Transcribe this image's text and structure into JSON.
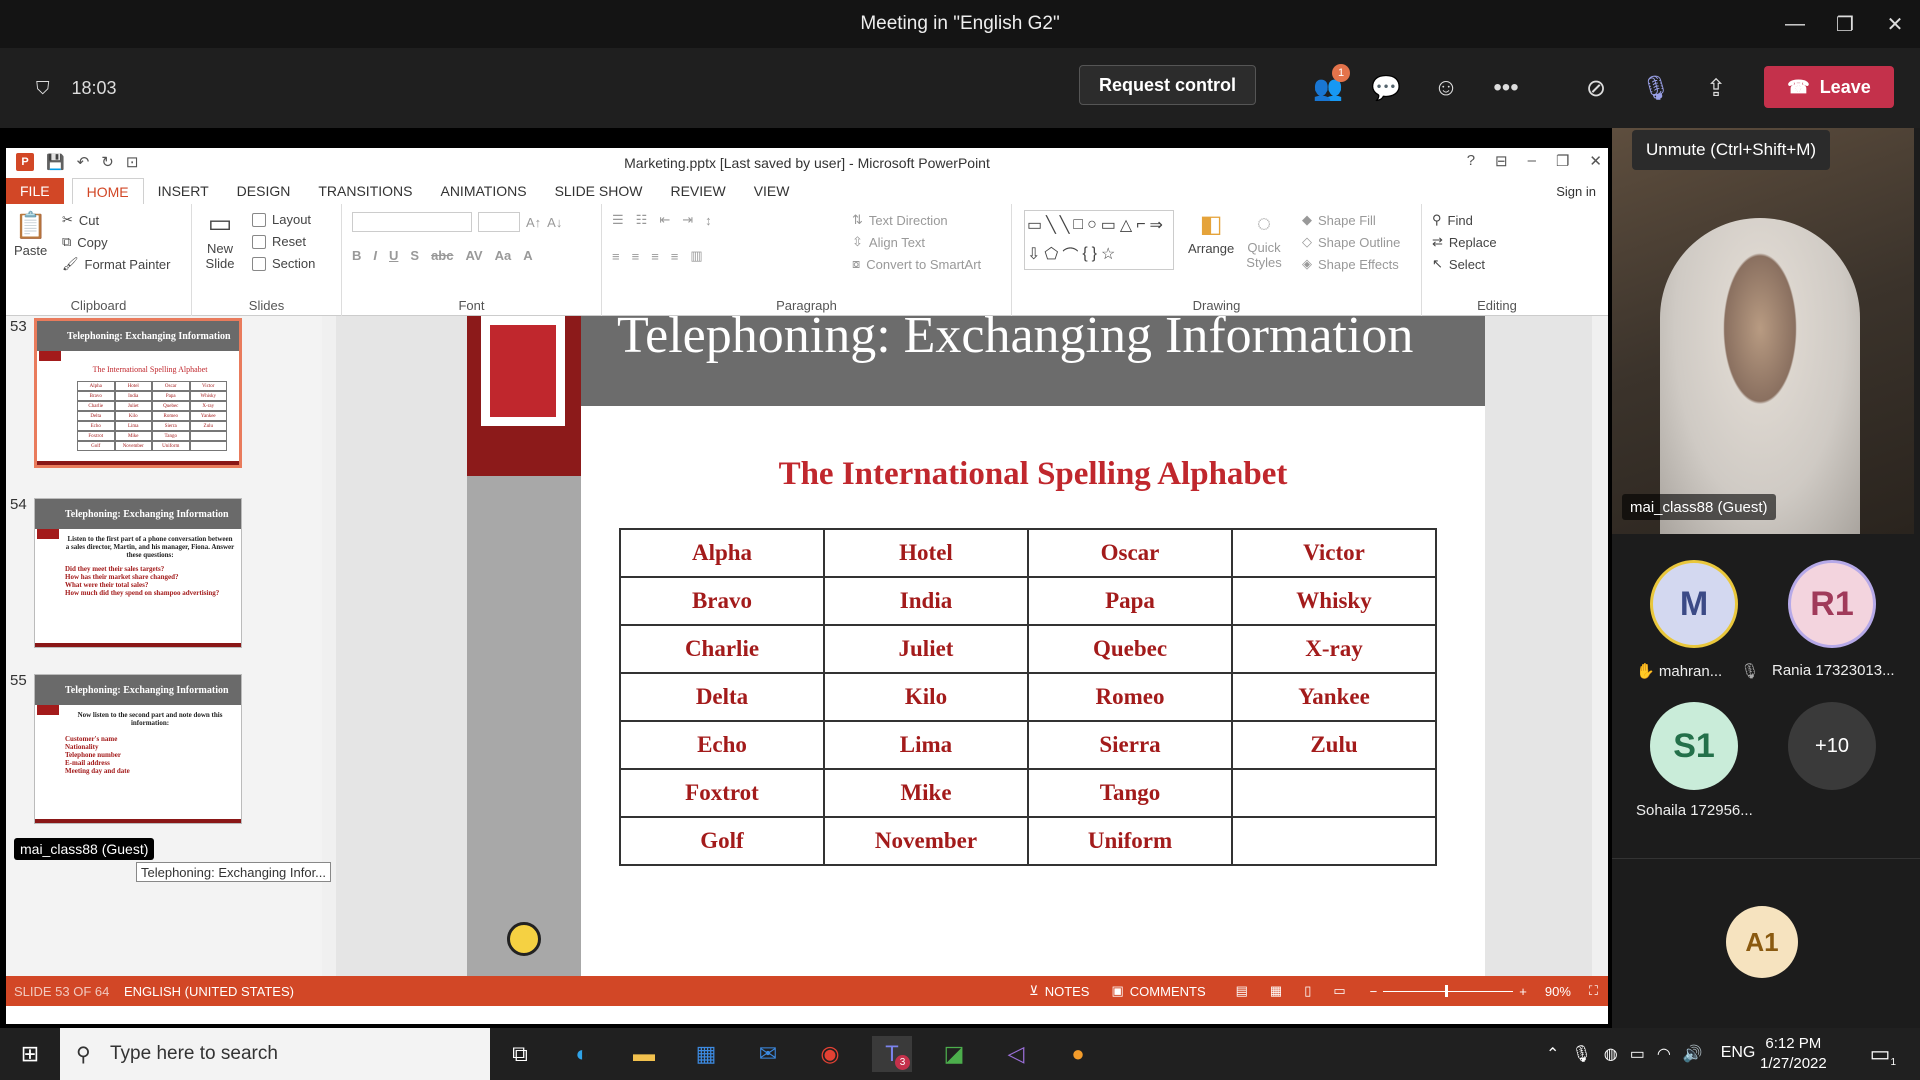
{
  "teams": {
    "window_title": "Meeting in \"English G2\"",
    "timer": "18:03",
    "request_control": "Request control",
    "participants_badge": "1",
    "leave": "Leave",
    "unmute_tooltip": "Unmute (Ctrl+Shift+M)"
  },
  "ppt": {
    "title": "Marketing.pptx [Last saved by user] - Microsoft PowerPoint",
    "signin": "Sign in",
    "tabs": [
      "FILE",
      "HOME",
      "INSERT",
      "DESIGN",
      "TRANSITIONS",
      "ANIMATIONS",
      "SLIDE SHOW",
      "REVIEW",
      "VIEW"
    ],
    "ribbon": {
      "clipboard": {
        "label": "Clipboard",
        "paste": "Paste",
        "cut": "Cut",
        "copy": "Copy",
        "format_painter": "Format Painter"
      },
      "slides": {
        "label": "Slides",
        "new_slide": "New Slide",
        "layout": "Layout",
        "reset": "Reset",
        "section": "Section"
      },
      "font": {
        "label": "Font"
      },
      "paragraph": {
        "label": "Paragraph",
        "text_direction": "Text Direction",
        "align_text": "Align Text",
        "smartart": "Convert to SmartArt"
      },
      "drawing": {
        "label": "Drawing",
        "arrange": "Arrange",
        "quick_styles": "Quick Styles",
        "shape_fill": "Shape Fill",
        "shape_outline": "Shape Outline",
        "shape_effects": "Shape Effects"
      },
      "editing": {
        "label": "Editing",
        "find": "Find",
        "replace": "Replace",
        "select": "Select"
      }
    },
    "thumbnails": [
      {
        "num": "53",
        "title": "Telephoning: Exchanging Information",
        "body": "The International Spelling Alphabet"
      },
      {
        "num": "54",
        "title": "Telephoning: Exchanging Information",
        "body": "Listen to the first part of a phone conversation between a sales director, Martin, and his manager, Fiona. Answer these questions:",
        "items": [
          "Did they meet their sales targets?",
          "How has their market share changed?",
          "What were their total sales?",
          "How much did they spend on shampoo advertising?"
        ]
      },
      {
        "num": "55",
        "title": "Telephoning: Exchanging Information",
        "body": "Now listen to the second part and note down this information:",
        "items": [
          "Customer's name",
          "Nationality",
          "Telephone number",
          "E-mail address",
          "Meeting day and date"
        ]
      }
    ],
    "thumb_tooltip": "Telephoning: Exchanging Infor...",
    "slide": {
      "title": "Telephoning: Exchanging Information",
      "subtitle": "The International Spelling Alphabet",
      "table": [
        [
          "Alpha",
          "Hotel",
          "Oscar",
          "Victor"
        ],
        [
          "Bravo",
          "India",
          "Papa",
          "Whisky"
        ],
        [
          "Charlie",
          "Juliet",
          "Quebec",
          "X-ray"
        ],
        [
          "Delta",
          "Kilo",
          "Romeo",
          "Yankee"
        ],
        [
          "Echo",
          "Lima",
          "Sierra",
          "Zulu"
        ],
        [
          "Foxtrot",
          "Mike",
          "Tango",
          ""
        ],
        [
          "Golf",
          "November",
          "Uniform",
          ""
        ]
      ]
    },
    "status": {
      "slide": "SLIDE 53 OF 64",
      "language": "ENGLISH (UNITED STATES)",
      "notes": "NOTES",
      "comments": "COMMENTS",
      "zoom": "90%"
    },
    "guest_label": "mai_class88 (Guest)"
  },
  "participants": {
    "video_name": "mai_class88 (Guest)",
    "avatars": [
      {
        "initials": "M",
        "name": "mahran...",
        "color": "#d3d8f0"
      },
      {
        "initials": "R1",
        "name": "Rania 17323013...",
        "color": "#f3d4de"
      },
      {
        "initials": "S1",
        "name": "Sohaila 172956...",
        "color": "#c9ecd9"
      },
      {
        "initials": "+10",
        "name": "",
        "color": "#3a3a3a"
      },
      {
        "initials": "A1",
        "name": "",
        "color": "#f6e3bf"
      }
    ]
  },
  "taskbar": {
    "search_placeholder": "Type here to search",
    "lang": "ENG",
    "time": "6:12 PM",
    "date": "1/27/2022",
    "teams_badge": "3",
    "notif_badge": "1"
  }
}
